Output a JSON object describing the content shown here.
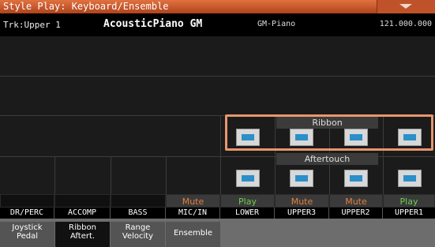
{
  "title": "Style Play: Keyboard/Ensemble",
  "track": {
    "label": "Trk:Upper 1",
    "sound": "AcousticPiano GM",
    "bank": "GM-Piano",
    "program": "121.000.000"
  },
  "sections": {
    "ribbon": "Ribbon",
    "aftertouch": "Aftertouch"
  },
  "colors": {
    "title_bar": "#c8552b",
    "highlight": "#e8956f",
    "switch_led": "#2b8fc9",
    "mute_text": "#e0803f",
    "play_text": "#6fcf4f"
  },
  "status": [
    "",
    "",
    "",
    "Mute",
    "Play",
    "Mute",
    "Mute",
    "Play"
  ],
  "tracks": [
    "DR/PERC",
    "ACCOMP",
    "BASS",
    "MIC/IN",
    "LOWER",
    "UPPER3",
    "UPPER2",
    "UPPER1"
  ],
  "tabs": [
    {
      "line1": "Joystick",
      "line2": "Pedal"
    },
    {
      "line1": "Ribbon",
      "line2": "Aftert."
    },
    {
      "line1": "Range",
      "line2": "Velocity"
    },
    {
      "line1": "Ensemble",
      "line2": ""
    }
  ],
  "menu_icon": "chevron-down-icon"
}
